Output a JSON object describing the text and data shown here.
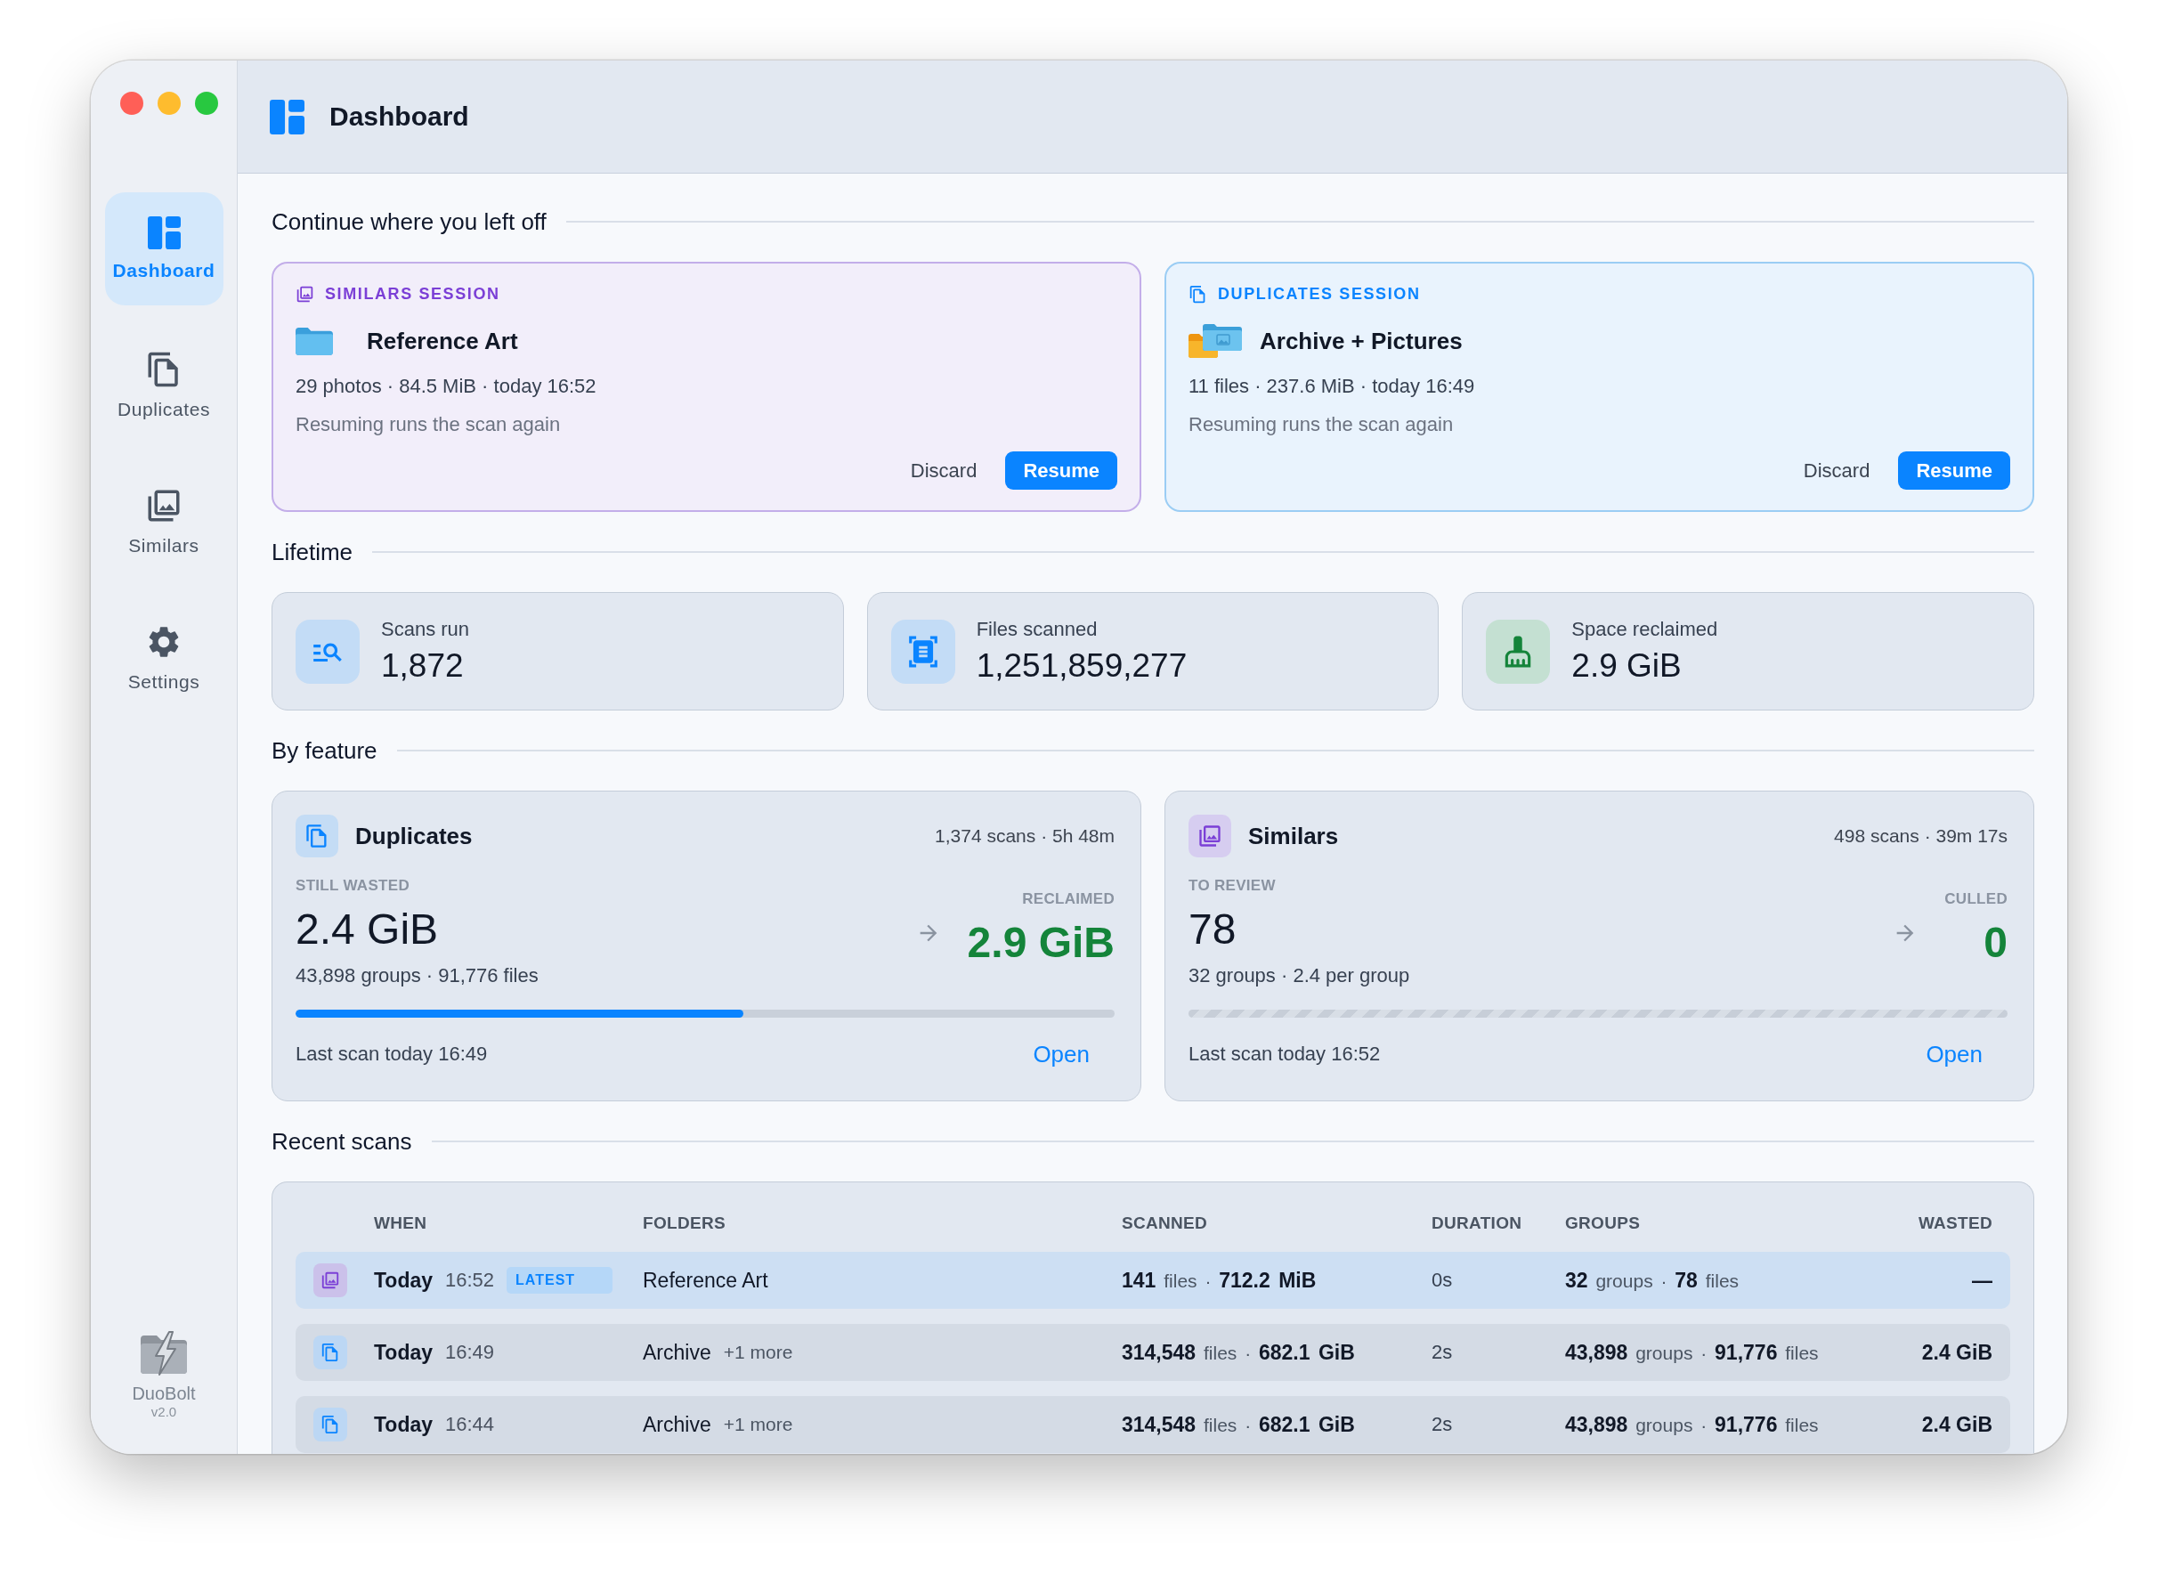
{
  "window": {
    "title": "Dashboard"
  },
  "sidebar": {
    "items": [
      {
        "kind": "dashboard",
        "label": "Dashboard",
        "selected": true
      },
      {
        "kind": "duplicates",
        "label": "Duplicates",
        "selected": false
      },
      {
        "kind": "similars",
        "label": "Similars",
        "selected": false
      },
      {
        "kind": "settings",
        "label": "Settings",
        "selected": false
      }
    ],
    "app_name": "DuoBolt",
    "version": "v2.0"
  },
  "continue_section": {
    "heading": "Continue where you left off",
    "sessions": [
      {
        "kind": "similars",
        "label": "SIMILARS SESSION",
        "name": "Reference Art",
        "meta": "29 photos · 84.5 MiB · today 16:52",
        "hint": "Resuming runs the scan again",
        "discard_button": "Discard",
        "resume_button": "Resume"
      },
      {
        "kind": "duplicates",
        "label": "DUPLICATES SESSION",
        "name": "Archive + Pictures",
        "meta": "11 files · 237.6 MiB · today 16:49",
        "hint": "Resuming runs the scan again",
        "discard_button": "Discard",
        "resume_button": "Resume"
      }
    ]
  },
  "lifetime": {
    "heading": "Lifetime",
    "stats": [
      {
        "kind": "scans",
        "label": "Scans run",
        "value": "1,872"
      },
      {
        "kind": "files",
        "label": "Files scanned",
        "value": "1,251,859,277"
      },
      {
        "kind": "space",
        "label": "Space reclaimed",
        "value": "2.9 GiB"
      }
    ]
  },
  "by_feature": {
    "heading": "By feature",
    "features": [
      {
        "kind": "duplicates",
        "title": "Duplicates",
        "summary": "1,374 scans · 5h 48m",
        "current_label": "STILL WASTED",
        "current_value": "2.4 GiB",
        "detail": "43,898 groups · 91,776 files",
        "result_label": "RECLAIMED",
        "result_value": "2.9 GiB",
        "level": 0.547,
        "last_scan": "Last scan today 16:49",
        "action": "Open"
      },
      {
        "kind": "similars",
        "title": "Similars",
        "summary": "498 scans · 39m 17s",
        "current_label": "TO REVIEW",
        "current_value": "78",
        "detail": "32 groups · 2.4 per group",
        "result_label": "CULLED",
        "result_value": "0",
        "last_scan": "Last scan today 16:52",
        "action": "Open"
      }
    ]
  },
  "recent_scans": {
    "heading": "Recent scans",
    "columns": [
      "WHEN",
      "FOLDERS",
      "SCANNED",
      "DURATION",
      "GROUPS",
      "WASTED"
    ],
    "rows": [
      {
        "kind": "similars",
        "selected": true,
        "day": "Today",
        "time": "16:52",
        "badge": "LATEST",
        "folder": "Reference Art",
        "scanned": "**141** files · **712.2 MiB**",
        "duration": "0s",
        "groups": "**32** groups · **78** files",
        "wasted": "—"
      },
      {
        "kind": "duplicates",
        "selected": false,
        "day": "Today",
        "time": "16:49",
        "folder": "Archive",
        "more": "+1 more",
        "scanned": "**314,548** files · **682.1 GiB**",
        "duration": "2s",
        "groups": "**43,898** groups · **91,776** files",
        "wasted": "2.4 GiB"
      },
      {
        "kind": "duplicates",
        "selected": false,
        "day": "Today",
        "time": "16:44",
        "folder": "Archive",
        "more": "+1 more",
        "scanned": "**314,548** files · **682.1 GiB**",
        "duration": "2s",
        "groups": "**43,898** groups · **91,776** files",
        "wasted": "2.4 GiB"
      }
    ]
  }
}
